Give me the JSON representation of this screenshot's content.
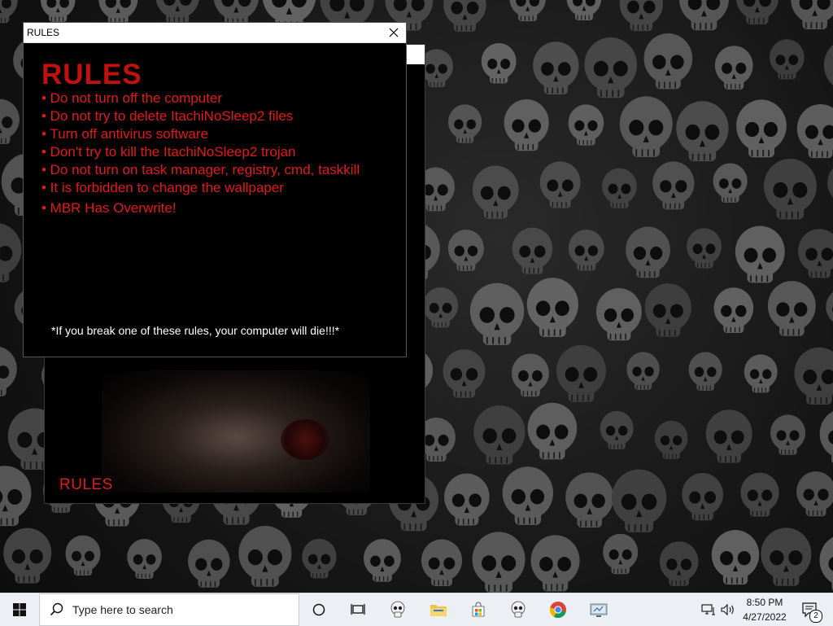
{
  "rules_window": {
    "title": "RULES",
    "heading": "RULES",
    "rules": [
      "• Do not turn off the computer",
      "• Do not try to delete ItachiNoSleep2 files",
      "• Turn off antivirus software",
      "• Don't try to kill the ItachiNoSleep2 trojan",
      "• Do not turn on task manager, registry, cmd, taskkill",
      "• It is forbidden to change the wallpaper",
      "• MBR Has Overwrite!"
    ],
    "warning": "*If you break one of these rules, your computer will die!!!*"
  },
  "back_window": {
    "label": "RULES"
  },
  "taskbar": {
    "search_placeholder": "Type here to search",
    "time": "8:50 PM",
    "date": "4/27/2022",
    "notification_count": "2"
  },
  "colors": {
    "rules_red": "#e01b1b",
    "heading_red": "#c01010",
    "taskbar_bg": "#eceff3"
  }
}
